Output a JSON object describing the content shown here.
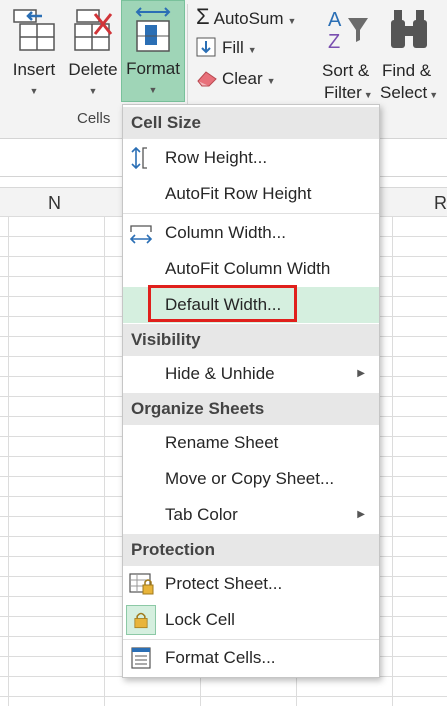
{
  "ribbon": {
    "insert": "Insert",
    "delete": "Delete",
    "format": "Format",
    "cells_group": "Cells",
    "autosum": "AutoSum",
    "fill": "Fill",
    "clear": "Clear",
    "sort_filter_line1": "Sort &",
    "sort_filter_line2": "Filter",
    "find_select_line1": "Find &",
    "find_select_line2": "Select",
    "sigma": "Σ"
  },
  "columns": [
    "N",
    "R"
  ],
  "menu": {
    "sections": {
      "cell_size": "Cell Size",
      "visibility": "Visibility",
      "organize": "Organize Sheets",
      "protection": "Protection"
    },
    "items": {
      "row_height": "Row Height...",
      "autofit_row": "AutoFit Row Height",
      "column_width": "Column Width...",
      "autofit_column": "AutoFit Column Width",
      "default_width": "Default Width...",
      "hide_unhide": "Hide & Unhide",
      "rename_sheet": "Rename Sheet",
      "move_copy": "Move or Copy Sheet...",
      "tab_color": "Tab Color",
      "protect_sheet": "Protect Sheet...",
      "lock_cell": "Lock Cell",
      "format_cells": "Format Cells..."
    }
  },
  "colors": {
    "accent_green": "#9fd5b7",
    "highlight": "#d5efdf",
    "red_box": "#e0201c",
    "icon_blue": "#2b6fb5"
  }
}
